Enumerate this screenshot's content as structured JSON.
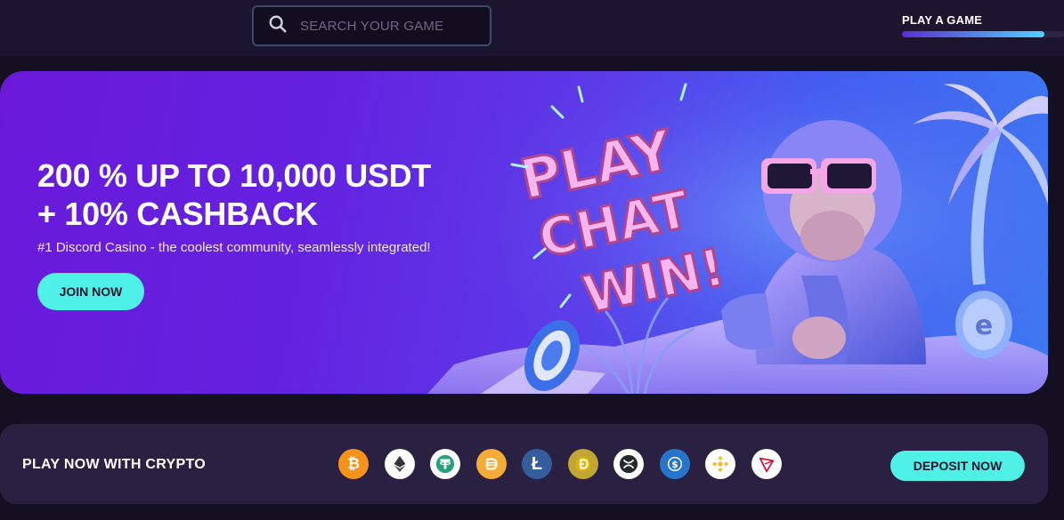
{
  "header": {
    "search": {
      "placeholder": "SEARCH YOUR GAME"
    },
    "play_label": "PLAY A GAME",
    "play_progress": 0.88
  },
  "hero": {
    "title_line1": "200 % UP TO 10,000 USDT",
    "title_line2": "+ 10% CASHBACK",
    "subtitle": "#1 Discord Casino - the coolest community, seamlessly integrated!",
    "join_label": "JOIN NOW",
    "art_text": [
      "PLAY",
      "CHAT",
      "WIN!"
    ]
  },
  "crypto": {
    "label": "PLAY NOW WITH CRYPTO",
    "deposit_label": "DEPOSIT NOW",
    "coins": [
      {
        "name": "bitcoin-icon",
        "color": "#f7931a"
      },
      {
        "name": "ethereum-icon",
        "color": "#ffffff"
      },
      {
        "name": "tether-icon",
        "color": "#ffffff"
      },
      {
        "name": "dai-icon",
        "color": "#f5ac37"
      },
      {
        "name": "litecoin-icon",
        "color": "#345d9d"
      },
      {
        "name": "dogecoin-icon",
        "color": "#c2a633"
      },
      {
        "name": "xrp-icon",
        "color": "#ffffff"
      },
      {
        "name": "usdc-icon",
        "color": "#2775ca"
      },
      {
        "name": "bnb-icon",
        "color": "#ffffff"
      },
      {
        "name": "tron-icon",
        "color": "#ffffff"
      }
    ]
  },
  "colors": {
    "accent": "#4ff0e6",
    "background": "#150f22",
    "hero_purple": "#6a19d9"
  }
}
